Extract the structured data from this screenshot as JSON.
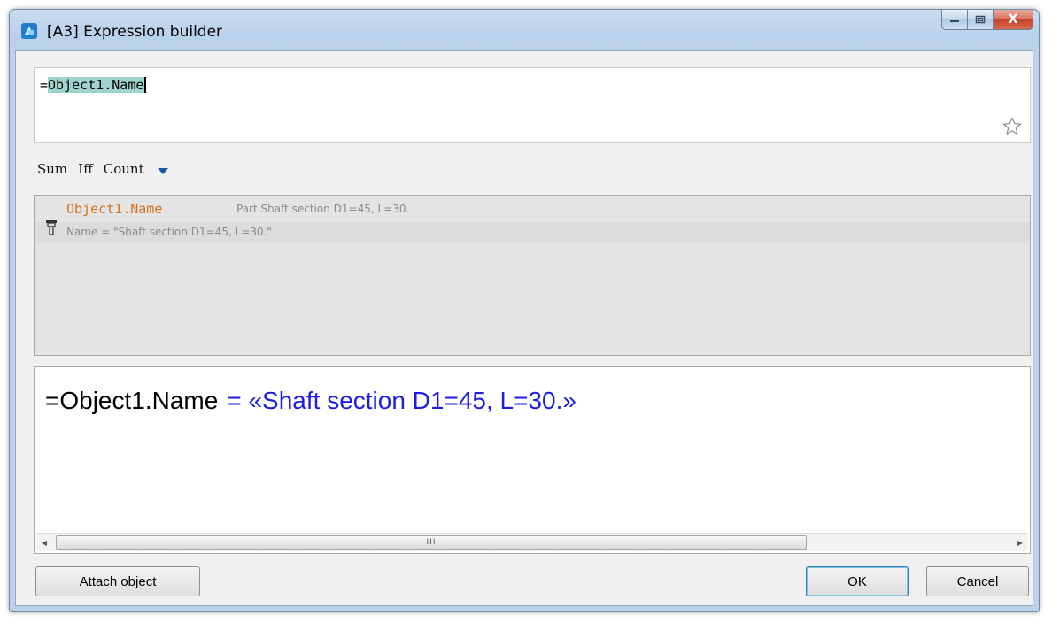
{
  "window": {
    "title": "[A3] Expression builder",
    "close_glyph": "X"
  },
  "expression_input": {
    "prefix": "=",
    "selected_text": "Object1.Name"
  },
  "function_bar": {
    "items": [
      "Sum",
      "Iff",
      "Count"
    ]
  },
  "suggestion": {
    "name": "Object1.Name",
    "description": "Part Shaft section D1=45, L=30.",
    "value_line": "Name = \"Shaft section D1=45, L=30.\""
  },
  "preview": {
    "expression": "=Object1.Name",
    "result": "= «Shaft section D1=45, L=30.»"
  },
  "scrollbar": {
    "grip": "III",
    "left_arrow": "◀",
    "right_arrow": "▶"
  },
  "buttons": {
    "attach": "Attach object",
    "ok": "OK",
    "cancel": "Cancel"
  },
  "colors": {
    "selection": "#9fd4cc",
    "suggestion_name": "#d4711e",
    "result_text": "#1e1ee0",
    "titlebar": "#b9d1ea"
  },
  "icons": [
    "app-icon",
    "minimize-icon",
    "maximize-icon",
    "close-icon",
    "star-icon",
    "dropdown-arrow-icon",
    "shaft-part-icon"
  ]
}
